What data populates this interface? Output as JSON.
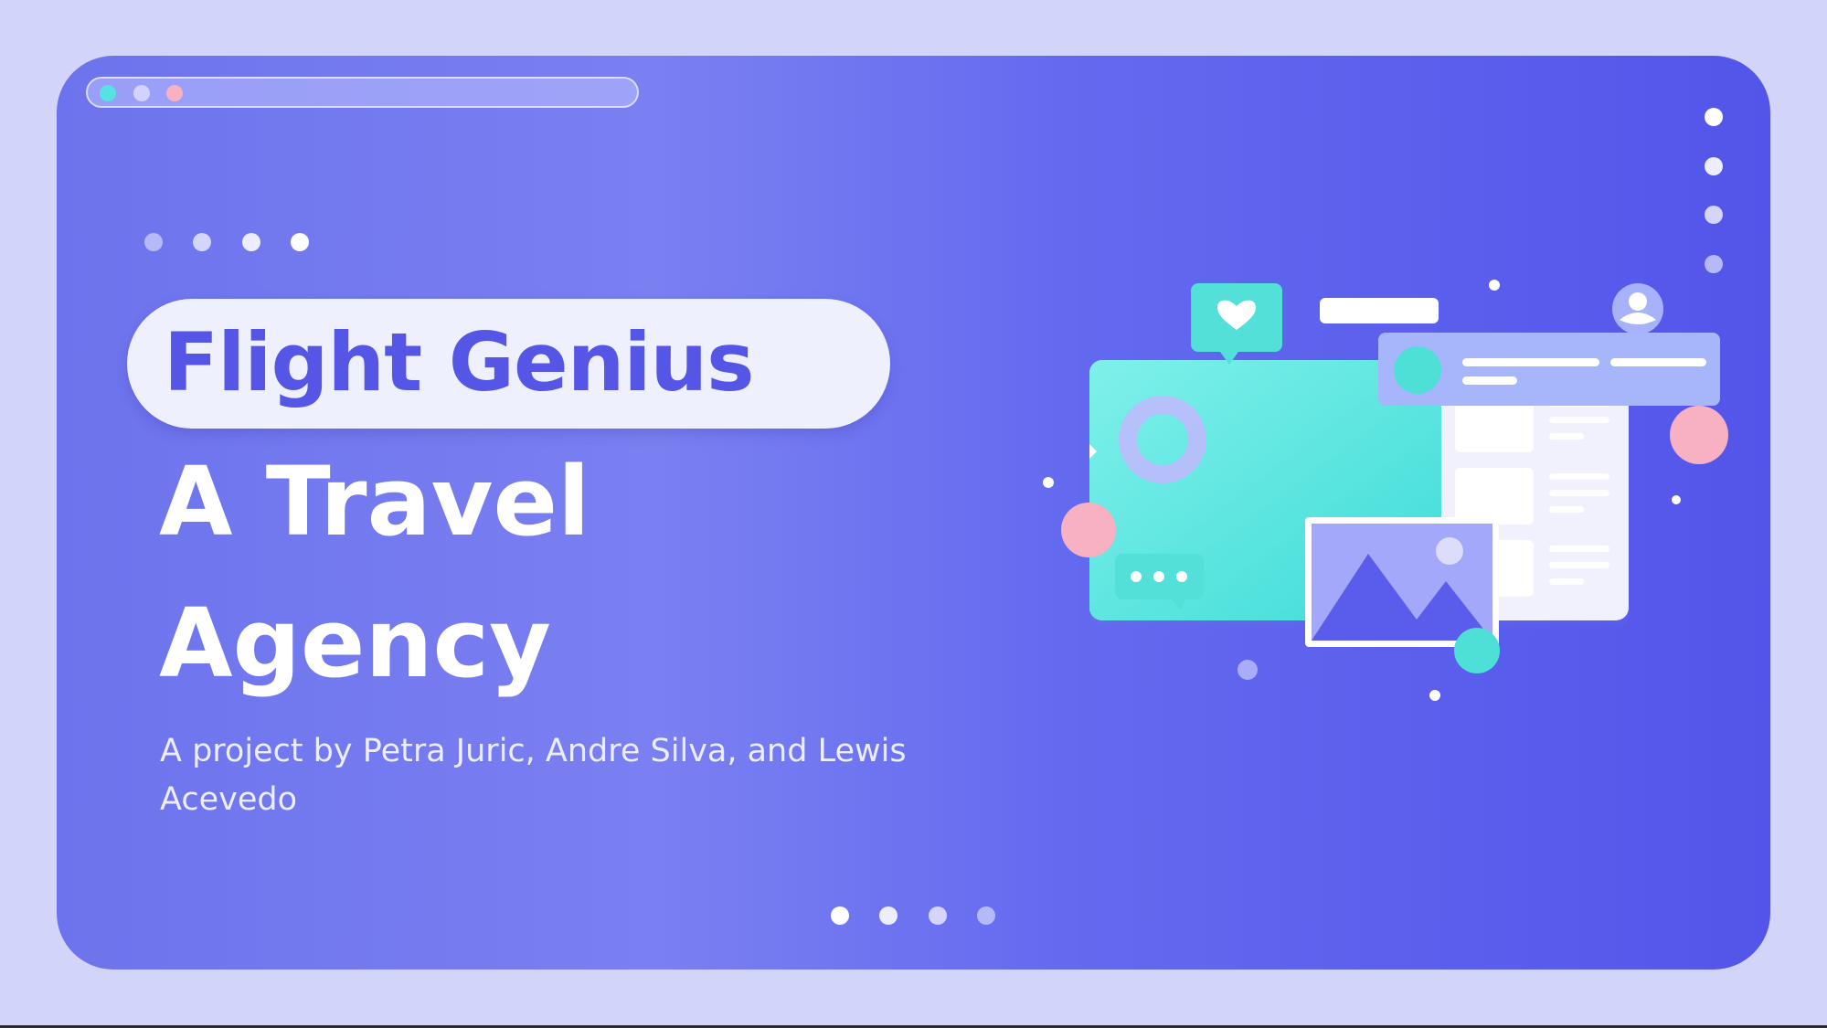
{
  "slide": {
    "title": "Flight Genius",
    "heading_line1": "A Travel",
    "heading_line2": "Agency",
    "subtitle": "A project by Petra Juric, Andre Silva, and Lewis Acevedo"
  },
  "colors": {
    "background": "#d3d4fa",
    "slide_gradient_start": "#6d73ec",
    "slide_gradient_end": "#5355ea",
    "title_text": "#5556e6",
    "accent_teal": "#55e2e0",
    "accent_pink": "#f7b1c2"
  },
  "illustration": {
    "icons": [
      "heart-icon",
      "user-avatar-icon",
      "image-placeholder-icon",
      "chat-bubble-icon",
      "ring-icon"
    ]
  }
}
